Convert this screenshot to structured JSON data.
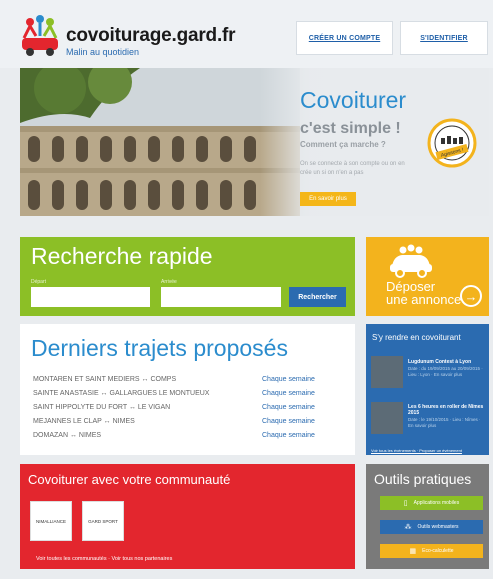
{
  "header": {
    "site_title": "covoiturage.gard.fr",
    "tagline": "Malin au quotidien",
    "create_account": "CRÉER UN COMPTE",
    "login": "S'IDENTIFIER"
  },
  "hero": {
    "title": "Covoiturer",
    "simple": "c'est simple !",
    "how": "Comment ça marche ?",
    "text": "On se connecte à son compte ou on en crée un si on n'en a pas",
    "more": "En savoir plus",
    "badge": "Agissons !"
  },
  "search": {
    "title": "Recherche rapide",
    "depart_label": "Départ",
    "arrivee_label": "Arrivée",
    "button": "Rechercher"
  },
  "deposit": {
    "line1": "Déposer",
    "line2": "une annonce",
    "arrow": "→"
  },
  "trips": {
    "title": "Derniers trajets proposés",
    "items": [
      {
        "route": "MONTAREN ET SAINT MEDIERS ↔ COMPS",
        "freq": "Chaque semaine"
      },
      {
        "route": "SAINTE ANASTASIE ↔ GALLARGUES LE MONTUEUX",
        "freq": "Chaque semaine"
      },
      {
        "route": "SAINT HIPPOLYTE DU FORT ↔ LE VIGAN",
        "freq": "Chaque semaine"
      },
      {
        "route": "MEJANNES LE CLAP ↔ NIMES",
        "freq": "Chaque semaine"
      },
      {
        "route": "DOMAZAN ↔ NIMES",
        "freq": "Chaque semaine"
      }
    ]
  },
  "events": {
    "title": "S'y rendre en covoiturant",
    "items": [
      {
        "title": "Lugdunum Contest à Lyon",
        "meta": "Date : du 19/09/2015 au 20/09/2015 · Lieu : Lyon · En savoir plus"
      },
      {
        "title": "Les 6 heures en roller de Nîmes 2015",
        "meta": "Date : le 19/10/2015 · Lieu : Nîmes · En savoir plus"
      }
    ],
    "links": "Voir tous les événements · Proposer un événement"
  },
  "community": {
    "title": "Covoiturer avec votre communauté",
    "partners": [
      "NIMALLIANCE",
      "GARD SPORT"
    ],
    "links": "Voir toutes les communautés  ·  Voir tous nos partenaires"
  },
  "tools": {
    "title": "Outils pratiques",
    "items": [
      {
        "label": "Applications mobiles",
        "icon": "phone-icon"
      },
      {
        "label": "Outils webmasters",
        "icon": "sitemap-icon"
      },
      {
        "label": "Eco-calculette",
        "icon": "calculator-icon"
      }
    ]
  },
  "colors": {
    "blue": "#2b8ccd",
    "dark_blue": "#2b6bb0",
    "green": "#8cbf26",
    "orange": "#f3b31d",
    "red": "#e3262e",
    "grey": "#7a7a7a"
  }
}
